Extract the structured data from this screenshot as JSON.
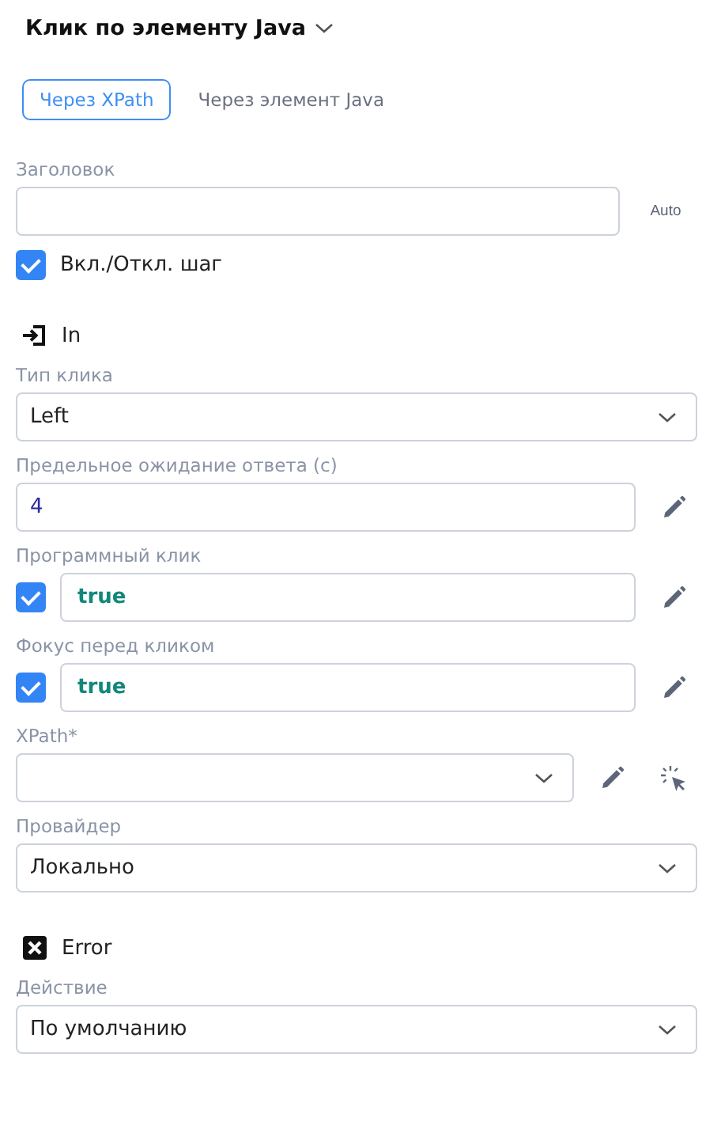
{
  "title": "Клик по элементу Java",
  "tabs": [
    {
      "label": "Через XPath",
      "selected": true
    },
    {
      "label": "Через элемент Java",
      "selected": false
    }
  ],
  "title_field": {
    "label": "Заголовок",
    "button": "Auto"
  },
  "step_toggle": {
    "label": "Вкл./Откл. шаг",
    "checked": true
  },
  "sections": [
    {
      "kind": "in",
      "title": "In",
      "fields": [
        {
          "kind": "select",
          "label": "Тип клика",
          "value": "Left"
        },
        {
          "kind": "input",
          "label": "Предельное ожидание ответа (с)",
          "value": "4"
        },
        {
          "kind": "check_input",
          "label": "Программный клик",
          "checked": true,
          "value": "true"
        },
        {
          "kind": "check_input",
          "label": "Фокус перед кликом",
          "checked": true,
          "value": "true"
        },
        {
          "kind": "xpath",
          "label": "XPath*"
        },
        {
          "kind": "select",
          "label": "Провайдер",
          "value": "Локально"
        }
      ]
    },
    {
      "kind": "error",
      "title": "Error",
      "fields": [
        {
          "kind": "select",
          "label": "Действие",
          "value": "По умолчанию"
        }
      ]
    }
  ]
}
